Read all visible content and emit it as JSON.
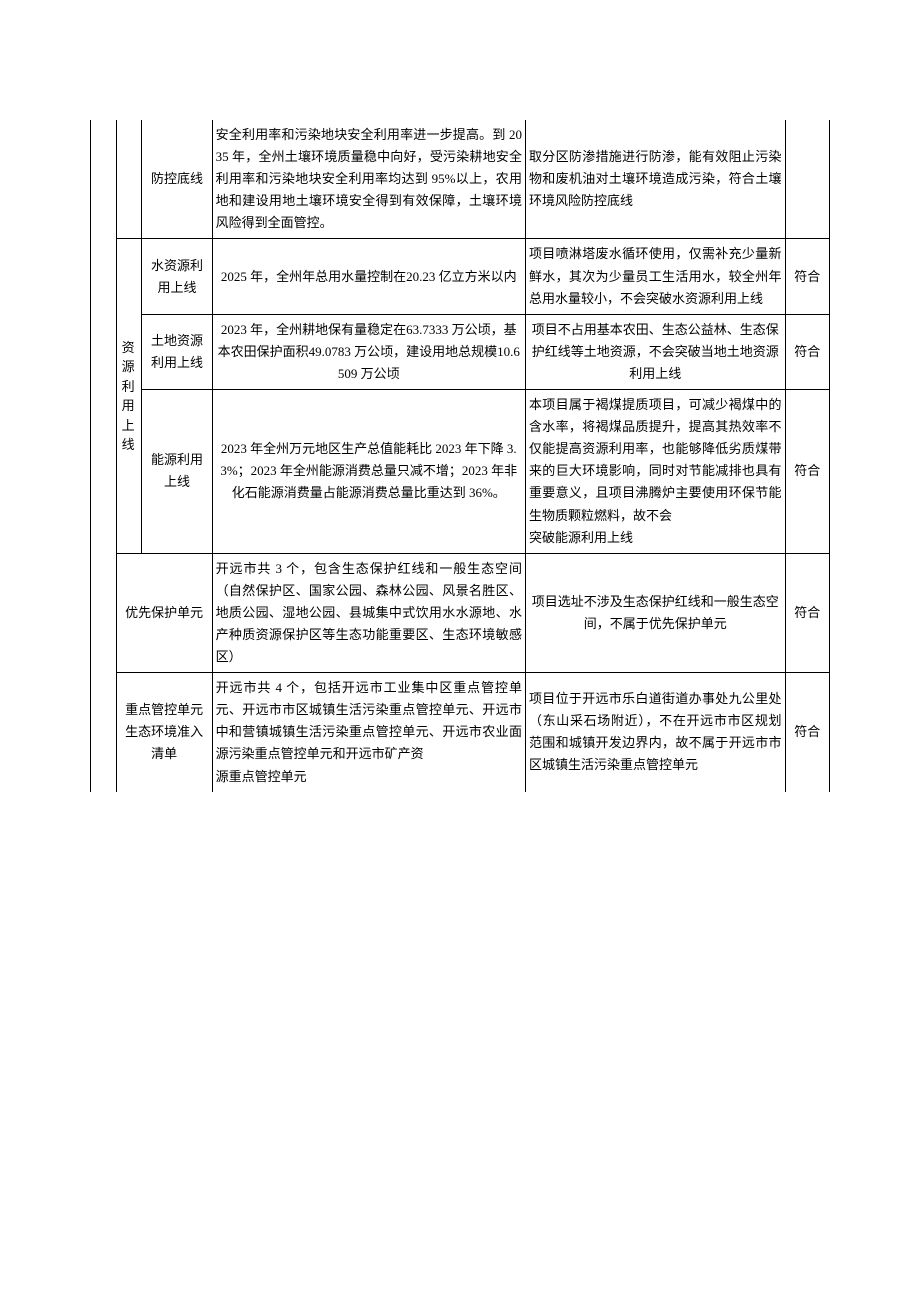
{
  "rows": [
    {
      "sub": "防控底线",
      "req": "安全利用率和污染地块安全利用率进一步提高。到 2035 年，全州土壤环境质量稳中向好，受污染耕地安全利用率和污染地块安全利用率均达到 95%以上，农用地和建设用地土壤环境安全得到有效保障，土壤环境风险得到全面管控。",
      "ana": "取分区防渗措施进行防渗，能有效阻止污染物和废机油对土壤环境造成污染，符合土壤环境风险防控底线",
      "res": ""
    },
    {
      "group": "资源利用上线",
      "sub": "水资源利用上线",
      "req": "2025 年，全州年总用水量控制在20.23 亿立方米以内",
      "ana": "项目喷淋塔废水循环使用，仅需补充少量新鲜水，其次为少量员工生活用水，较全州年总用水量较小，不会突破水资源利用上线",
      "res": "符合"
    },
    {
      "sub": "土地资源利用上线",
      "req": "2023 年，全州耕地保有量稳定在63.7333 万公顷，基本农田保护面积49.0783 万公顷，建设用地总规模10.6509 万公顷",
      "ana": "项目不占用基本农田、生态公益林、生态保护红线等土地资源，不会突破当地土地资源利用上线",
      "res": "符合"
    },
    {
      "sub": "能源利用上线",
      "req": "2023 年全州万元地区生产总值能耗比 2023 年下降 3.3%；2023 年全州能源消费总量只减不增；2023 年非化石能源消费量占能源消费总量比重达到 36%。",
      "ana": "本项目属于褐煤提质项目，可减少褐煤中的含水率，将褐煤品质提升，提高其热效率不仅能提高资源利用率，也能够降低劣质煤带来的巨大环境影响，同时对节能减排也具有重要意义，且项目沸腾炉主要使用环保节能生物质颗粒燃料，故不会\n突破能源利用上线",
      "res": "符合"
    },
    {
      "merge": "优先保护单元",
      "req": "开远市共 3 个，包含生态保护红线和一般生态空间（自然保护区、国家公园、森林公园、风景名胜区、地质公园、湿地公园、县城集中式饮用水水源地、水产种质资源保护区等生态功能重要区、生态环境敏感区）",
      "ana": "项目选址不涉及生态保护红线和一般生态空间，不属于优先保护单元",
      "res": "符合"
    },
    {
      "merge": "重点管控单元生态环境准入清单",
      "req": "开远市共 4 个，包括开远市工业集中区重点管控单元、开远市市区城镇生活污染重点管控单元、开远市中和营镇城镇生活污染重点管控单元、开远市农业面源污染重点管控单元和开远市矿产资\n源重点管控单元",
      "ana": "项目位于开远市乐白道街道办事处九公里处（东山采石场附近），不在开远市市区规划范围和城镇开发边界内，故不属于开远市市区城镇生活污染重点管控单元",
      "res": "符合"
    }
  ]
}
